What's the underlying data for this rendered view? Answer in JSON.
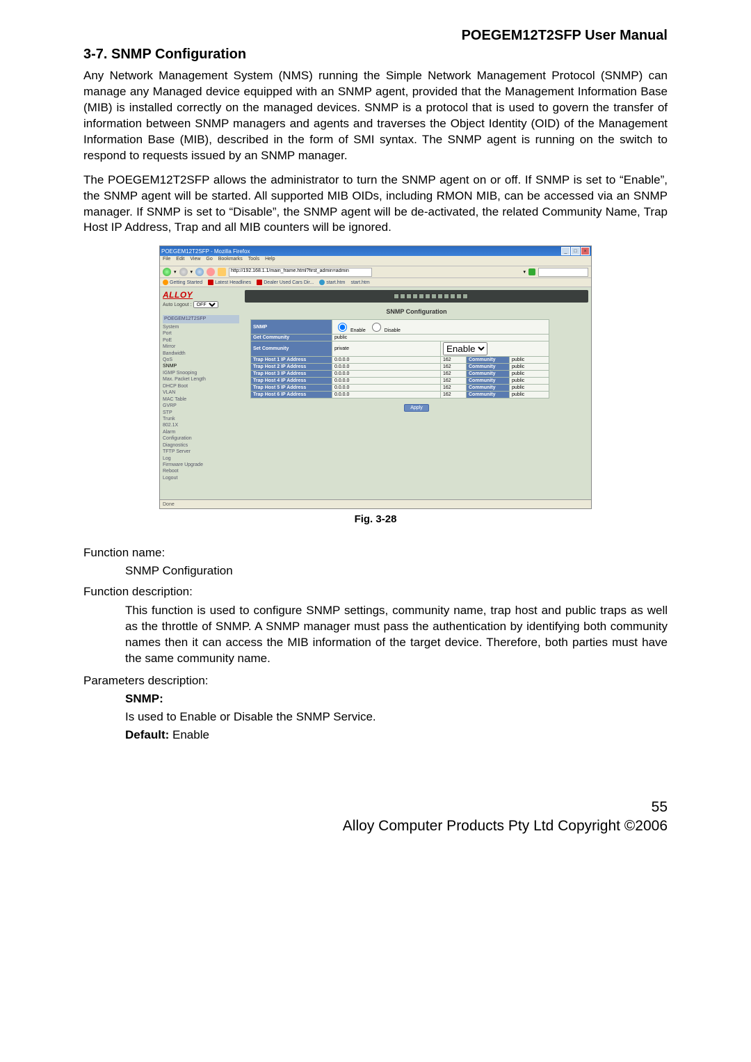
{
  "header": {
    "product_title": "POEGEM12T2SFP User Manual"
  },
  "section": {
    "title": "3-7. SNMP Configuration"
  },
  "para1": "Any Network Management System (NMS) running the Simple Network Management Protocol (SNMP) can manage any Managed device equipped with an SNMP agent, provided that the Management Information Base (MIB) is installed correctly on the managed devices. SNMP is a protocol that is used to govern the transfer of information between SNMP managers and agents and traverses the Object Identity (OID) of the Management Information Base (MIB), described in the form of SMI syntax. The SNMP agent is running on the switch to respond to requests issued by an SNMP manager.",
  "para2": "The POEGEM12T2SFP allows the administrator to turn the SNMP agent on or off. If SNMP is set to “Enable”, the SNMP agent will be started. All supported MIB OIDs, including RMON MIB, can be accessed via an SNMP manager. If SNMP is set to “Disable”, the SNMP agent will be de-activated, the related Community Name, Trap Host IP Address, Trap and all MIB counters will be ignored.",
  "figure_caption": "Fig. 3-28",
  "fn_name_label": "Function name:",
  "fn_name_value": "SNMP Configuration",
  "fn_desc_label": "Function description:",
  "fn_desc_value": "This function is used to configure SNMP settings, community name, trap host and public traps as well as the throttle of SNMP. A SNMP manager must pass the authentication by identifying both community names then it can access the MIB information of the target device. Therefore, both parties must have the same community name.",
  "params_label": "Parameters description:",
  "param_snmp": "SNMP:",
  "param_snmp_body": "Is used to Enable or Disable the SNMP Service.",
  "param_snmp_default_label": "Default:",
  "param_snmp_default_value": " Enable",
  "footer": {
    "page": "55",
    "copyright": "Alloy Computer Products Pty Ltd Copyright ©2006"
  },
  "browser": {
    "title": "POEGEM12T2SFP - Mozilla Firefox",
    "menu": [
      "File",
      "Edit",
      "View",
      "Go",
      "Bookmarks",
      "Tools",
      "Help"
    ],
    "address": "http://192.168.1.1/main_frame.html?first_admin=admin",
    "bookmarks": [
      "Getting Started",
      "Latest Headlines",
      "Dealer Used Cars Dir...",
      "start.htm",
      "start.htm"
    ],
    "statusbar": "Done"
  },
  "sidebar": {
    "brand": "ALLOY",
    "autologout_label": "Auto Logout :",
    "autologout_value": "OFF",
    "header": "POEGEM12T2SFP",
    "items": [
      "System",
      "Port",
      "PoE",
      "Mirror",
      "Bandwidth",
      "QoS",
      "SNMP",
      "IGMP Snooping",
      "Max. Packet Length",
      "DHCP Boot",
      "VLAN",
      "MAC Table",
      "GVRP",
      "STP",
      "Trunk",
      "802.1X",
      "Alarm",
      "Configuration",
      "Diagnostics",
      "TFTP Server",
      "Log",
      "Firmware Upgrade",
      "Reboot",
      "Logout"
    ]
  },
  "snmp_page": {
    "title": "SNMP Configuration",
    "rows": {
      "snmp_label": "SNMP",
      "enable": "Enable",
      "disable": "Disable",
      "get_label": "Get Community",
      "get_val": "public",
      "set_label": "Set Community",
      "set_val": "private",
      "set_enable": "Enable",
      "trap_prefix": "Trap Host ",
      "trap_suffix": " IP Address",
      "ip": "0.0.0.0",
      "port": "162",
      "comm_label": "Community",
      "comm_val": "public"
    },
    "apply": "Apply"
  }
}
